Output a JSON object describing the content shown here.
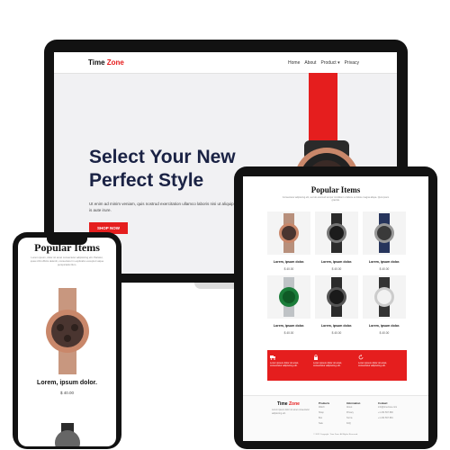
{
  "laptop": {
    "brand_main": "Time ",
    "brand_accent": "Zone",
    "menu": [
      "Home",
      "About",
      "Product ▾",
      "Privacy"
    ],
    "hero_title_line1": "Select Your New",
    "hero_title_line2": "Perfect Style",
    "hero_text": "Ut enim ad minim veniam, quis nostrud exercitation ullamco laboris nisi ut aliquip ex ea commodo consequat is aute irure.",
    "cta_label": "SHOP NOW"
  },
  "tablet": {
    "section_title": "Popular Items",
    "section_subtitle": "Consectetur adipiscing elit, sed do eiusmod tempor incididunt ut labore et dolore magna aliqua. Quis ipsum gravida.",
    "products": [
      {
        "name": "Lorem, ipsum dolor.",
        "price": "$ 40.00",
        "watch": "rose-gold"
      },
      {
        "name": "Lorem, ipsum dolor.",
        "price": "$ 40.00",
        "watch": "black"
      },
      {
        "name": "Lorem, ipsum dolor.",
        "price": "$ 40.00",
        "watch": "navy"
      },
      {
        "name": "Lorem, ipsum dolor.",
        "price": "$ 40.00",
        "watch": "green"
      },
      {
        "name": "Lorem, ipsum dolor.",
        "price": "$ 40.00",
        "watch": "black"
      },
      {
        "name": "Lorem, ipsum dolor.",
        "price": "$ 40.00",
        "watch": "silver"
      }
    ],
    "features": [
      {
        "icon": "truck-icon",
        "text": "Lorem ipsum dolor sit amet, consectetur adipiscing elit."
      },
      {
        "icon": "lock-icon",
        "text": "Lorem ipsum dolor sit amet, consectetur adipiscing elit."
      },
      {
        "icon": "refresh-icon",
        "text": "Lorem ipsum dolor sit amet, consectetur adipiscing elit."
      }
    ],
    "footer": {
      "brand_main": "Time ",
      "brand_accent": "Zone",
      "about": "Lorem ipsum dolor sit amet consectetur adipisicing elit.",
      "col1_title": "Products",
      "col1_items": [
        "Watch",
        "Strap",
        "Box",
        "Sale"
      ],
      "col2_title": "Information",
      "col2_items": [
        "About",
        "Privacy",
        "Terms",
        "FAQ"
      ],
      "col3_title": "Contact",
      "col3_items": [
        "info@timezone.com",
        "+1 234 567 890",
        "+1 234 567 891"
      ],
      "copyright": "© 2022 Copyright. Time Zone. All Rights Reserved."
    }
  },
  "phone": {
    "section_title": "Popular Items",
    "section_subtitle": "Lorem ipsum, dolor sit amet consectetur adipisicing elit. Pariatur, quas nihil officiis deleniti, consectetur in explicabo excepturi atque perspiciatis illum.",
    "product_name": "Lorem, ipsum dolor.",
    "product_price": "$ 40.00"
  },
  "colors": {
    "accent": "#e51e1e",
    "navy": "#1a2244",
    "frame": "#121212"
  }
}
